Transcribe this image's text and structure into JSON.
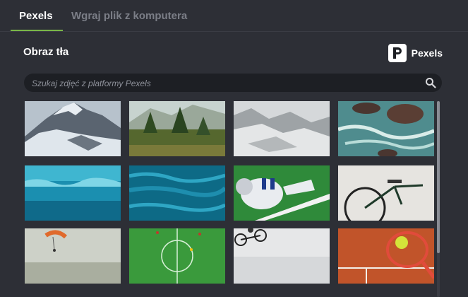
{
  "tabs": [
    {
      "label": "Pexels",
      "active": true
    },
    {
      "label": "Wgraj plik z komputera",
      "active": false
    }
  ],
  "section_title": "Obraz tła",
  "provider": {
    "name": "Pexels",
    "logo_icon": "pexels-logo-icon"
  },
  "search": {
    "placeholder": "Szukaj zdjęć z platformy Pexels",
    "value": "",
    "icon": "search-icon"
  },
  "images": [
    {
      "subject": "snowy-mountain-peak"
    },
    {
      "subject": "forest-valley"
    },
    {
      "subject": "snowy-ridge"
    },
    {
      "subject": "ocean-rocks-aerial"
    },
    {
      "subject": "underwater-surface"
    },
    {
      "subject": "sea-water-surface"
    },
    {
      "subject": "american-football-player"
    },
    {
      "subject": "bicycle-wall"
    },
    {
      "subject": "paraglider-sky"
    },
    {
      "subject": "soccer-field-aerial"
    },
    {
      "subject": "cyclist-jump"
    },
    {
      "subject": "tennis-racket-ball"
    }
  ],
  "colors": {
    "background": "#2d2f36",
    "active_tab_underline": "#7ab648",
    "search_bg": "#1d1f24"
  }
}
